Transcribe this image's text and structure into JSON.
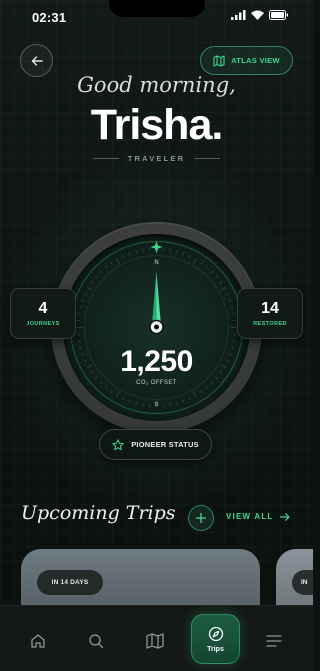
{
  "status_bar": {
    "time": "02:31",
    "icons": [
      "signal-icon",
      "wifi-icon",
      "battery-icon"
    ]
  },
  "header": {
    "back_icon": "arrow-left-icon",
    "atlas_button": {
      "icon": "map-icon",
      "label": "ATLAS VIEW"
    }
  },
  "greeting": {
    "salutation": "Good morning,",
    "name": "Trisha.",
    "rank": "TRAVELER"
  },
  "compass": {
    "markings": [
      "N",
      "S"
    ],
    "stats": {
      "journeys": {
        "value": "4",
        "label": "JOURNEYS"
      },
      "restored": {
        "value": "14",
        "label": "RESTORED"
      }
    },
    "offset": {
      "value": "1,250",
      "label": "CO₂ OFFSET"
    },
    "status_button": {
      "icon": "star-icon",
      "label": "PIONEER STATUS"
    }
  },
  "upcoming": {
    "title": "Upcoming Trips",
    "add_icon": "plus-icon",
    "view_all": "VIEW ALL",
    "trips": [
      {
        "badge": "IN 14 DAYS"
      },
      {
        "badge": "IN"
      }
    ]
  },
  "tabbar": {
    "tabs": [
      {
        "icon": "home-icon"
      },
      {
        "icon": "search-icon"
      },
      {
        "icon": "map-icon"
      },
      {
        "icon": "compass-icon",
        "label": "Trips",
        "active": true
      },
      {
        "icon": "menu-icon"
      }
    ]
  },
  "colors": {
    "accent": "#3fd68f",
    "background": "#0c1210",
    "active_tab": "#1d5c43"
  }
}
